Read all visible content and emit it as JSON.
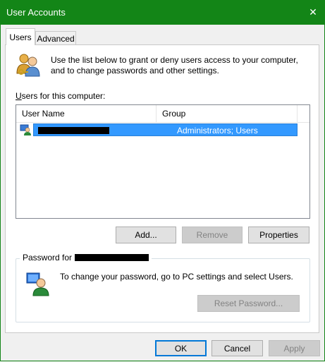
{
  "window": {
    "title": "User Accounts",
    "close_glyph": "✕",
    "accent_color": "#138517"
  },
  "tabs": [
    {
      "label": "Users",
      "active": true
    },
    {
      "label": "Advanced",
      "active": false
    }
  ],
  "users_tab": {
    "intro_text": "Use the list below to grant or deny users access to your computer, and to change passwords and other settings.",
    "intro_icon": "users-icon",
    "list_label": "Users for this computer:",
    "columns": [
      "User Name",
      "Group"
    ],
    "rows": [
      {
        "user_name": "",
        "group": "Administrators; Users",
        "selected": true,
        "icon": "user-icon"
      }
    ],
    "buttons": {
      "add": "Add...",
      "remove": "Remove",
      "properties": "Properties"
    },
    "password_group": {
      "legend": "Password for",
      "icon": "password-icon",
      "text": "To change your password, go to PC settings and select Users.",
      "reset_button": "Reset Password..."
    }
  },
  "footer": {
    "ok": "OK",
    "cancel": "Cancel",
    "apply": "Apply"
  }
}
